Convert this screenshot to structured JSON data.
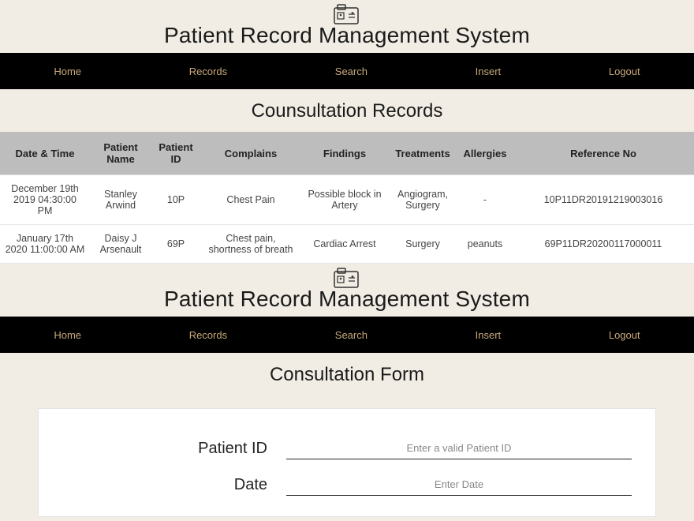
{
  "app": {
    "title": "Patient Record Management System"
  },
  "nav": {
    "items": [
      "Home",
      "Records",
      "Search",
      "Insert",
      "Logout"
    ]
  },
  "records_section": {
    "title": "Counsultation Records",
    "columns": [
      "Date & Time",
      "Patient Name",
      "Patient ID",
      "Complains",
      "Findings",
      "Treatments",
      "Allergies",
      "Reference No"
    ],
    "rows": [
      {
        "datetime": "December 19th 2019 04:30:00 PM",
        "patient_name": "Stanley Arwind",
        "patient_id": "10P",
        "complains": "Chest Pain",
        "findings": "Possible block in Artery",
        "treatments": "Angiogram, Surgery",
        "allergies": "-",
        "reference_no": "10P11DR20191219003016"
      },
      {
        "datetime": "January 17th 2020 11:00:00 AM",
        "patient_name": "Daisy J Arsenault",
        "patient_id": "69P",
        "complains": "Chest pain, shortness of breath",
        "findings": "Cardiac Arrest",
        "treatments": "Surgery",
        "allergies": "peanuts",
        "reference_no": "69P11DR20200117000011"
      }
    ]
  },
  "form_section": {
    "title": "Consultation Form",
    "fields": {
      "patient_id": {
        "label": "Patient ID",
        "placeholder": "Enter a valid Patient ID"
      },
      "date": {
        "label": "Date",
        "placeholder": "Enter Date"
      }
    }
  }
}
